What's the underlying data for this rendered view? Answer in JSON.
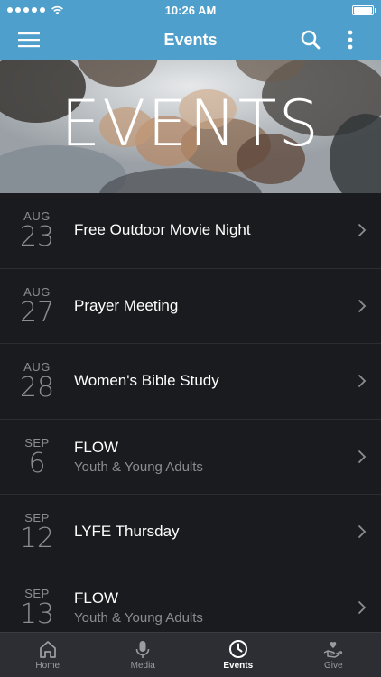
{
  "status_bar": {
    "time": "10:26 AM",
    "signal_dots": 5,
    "battery_level": 1.0
  },
  "nav": {
    "title": "Events"
  },
  "hero": {
    "title": "EVENTS"
  },
  "events": [
    {
      "month": "AUG",
      "day": "23",
      "title": "Free Outdoor Movie Night",
      "subtitle": ""
    },
    {
      "month": "AUG",
      "day": "27",
      "title": "Prayer Meeting",
      "subtitle": ""
    },
    {
      "month": "AUG",
      "day": "28",
      "title": "Women's Bible Study",
      "subtitle": ""
    },
    {
      "month": "SEP",
      "day": "6",
      "title": "FLOW",
      "subtitle": "Youth & Young Adults"
    },
    {
      "month": "SEP",
      "day": "12",
      "title": "LYFE Thursday",
      "subtitle": ""
    },
    {
      "month": "SEP",
      "day": "13",
      "title": "FLOW",
      "subtitle": "Youth & Young Adults"
    }
  ],
  "tabs": [
    {
      "label": "Home",
      "icon": "home-icon"
    },
    {
      "label": "Media",
      "icon": "microphone-icon"
    },
    {
      "label": "Events",
      "icon": "clock-icon",
      "active": true
    },
    {
      "label": "Give",
      "icon": "give-hand-heart-icon"
    }
  ],
  "colors": {
    "brand": "#4e9fcc",
    "background": "#1a1b1e",
    "tab_bar": "#2c2e33"
  }
}
